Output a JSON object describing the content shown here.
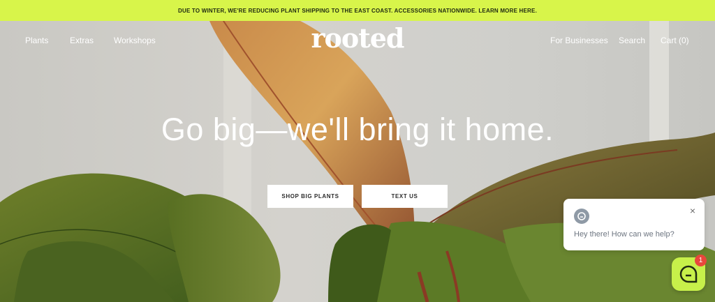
{
  "announcement": "DUE TO WINTER, WE'RE REDUCING PLANT SHIPPING TO THE EAST COAST. ACCESSORIES NATIONWIDE. LEARN MORE HERE.",
  "nav": {
    "left": [
      "Plants",
      "Extras",
      "Workshops"
    ],
    "logo": "rooted",
    "right": {
      "for_businesses": "For Businesses",
      "search": "Search",
      "cart": "Cart (0)"
    }
  },
  "hero": {
    "headline": "Go big—we'll bring it home.",
    "buttons": {
      "shop": "SHOP BIG PLANTS",
      "text": "TEXT US"
    }
  },
  "chat": {
    "message": "Hey there! How can we help?",
    "badge_count": "1",
    "close_symbol": "×"
  },
  "colors": {
    "accent": "#d8f54a",
    "chat_launcher": "#c7f04a",
    "badge": "#e8473c"
  },
  "icons": [
    "chat-avatar-icon",
    "close-icon",
    "chat-launcher-icon"
  ]
}
